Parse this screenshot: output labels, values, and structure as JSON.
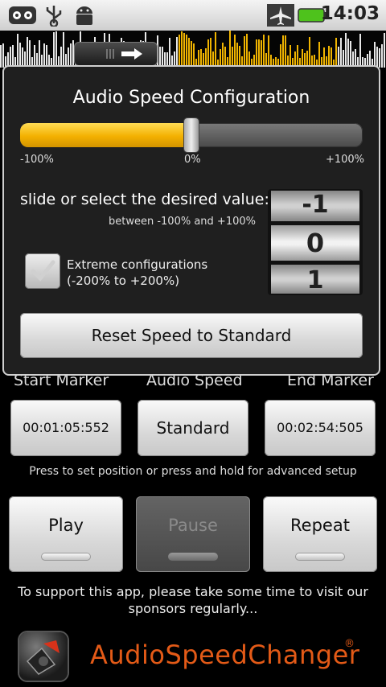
{
  "status_bar": {
    "time": "14:03",
    "icons": [
      "voicemail-icon",
      "usb-icon",
      "android-debug-icon",
      "airplane-mode-icon",
      "battery-icon"
    ]
  },
  "dialog": {
    "title": "Audio Speed Configuration",
    "slider": {
      "value_percent": 0,
      "min_label": "-100%",
      "mid_label": "0%",
      "max_label": "+100%"
    },
    "prompt": "slide or select the desired value:",
    "range_hint": "between -100% and +100%",
    "extreme_checkbox": {
      "line1": "Extreme configurations",
      "line2": "(-200% to +200%)",
      "checked": false
    },
    "picker": {
      "prev": "-1",
      "current": "0",
      "next": "1"
    },
    "reset_button": "Reset Speed to Standard"
  },
  "main": {
    "start_marker_label": "Start Marker",
    "audio_speed_label": "Audio Speed",
    "end_marker_label": "End Marker",
    "start_time": "00:01:05:552",
    "speed_value": "Standard",
    "end_time": "00:02:54:505",
    "hint": "Press to set position or press and hold for advanced setup",
    "play_label": "Play",
    "pause_label": "Pause",
    "repeat_label": "Repeat",
    "support_text": "To support this app, please take some time to visit our sponsors regularly...",
    "brand": "AudioSpeedChanger",
    "registered": "®"
  },
  "colors": {
    "accent": "#f3b000",
    "brand": "#e35a17"
  }
}
